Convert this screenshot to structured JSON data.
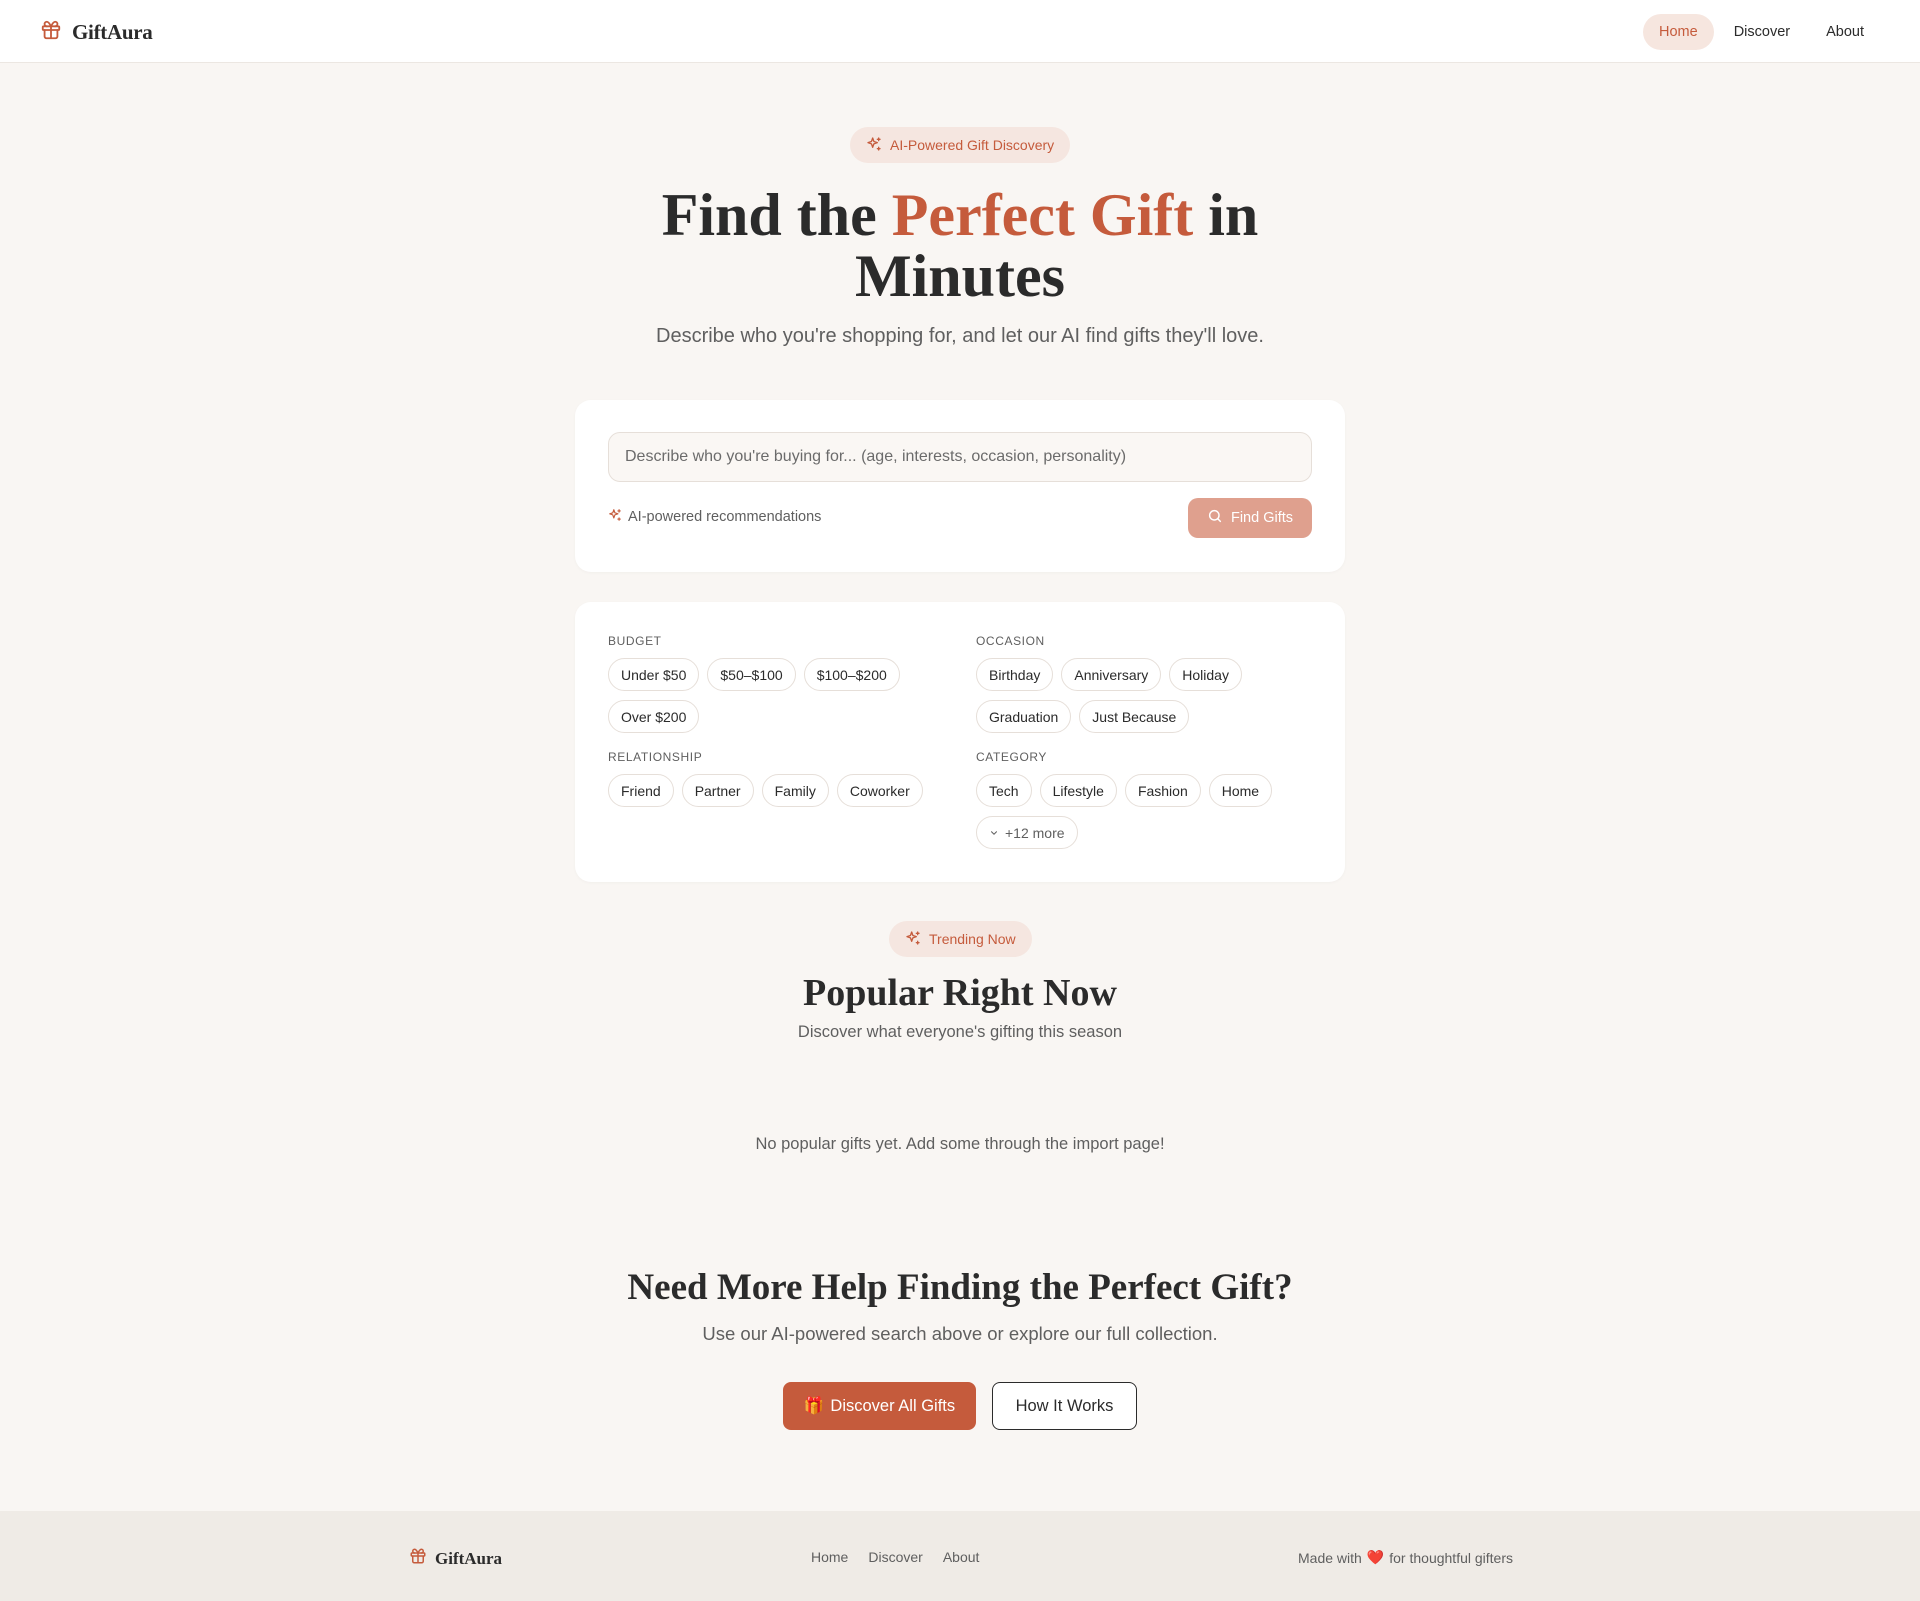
{
  "header": {
    "brand": "GiftAura",
    "nav": [
      "Home",
      "Discover",
      "About"
    ],
    "active_nav": "Home"
  },
  "hero": {
    "badge": "AI-Powered Gift Discovery",
    "title_pre": "Find the ",
    "title_accent": "Perfect Gift",
    "title_post": " in Minutes",
    "subtitle": "Describe who you're shopping for, and let our AI find gifts they'll love."
  },
  "search": {
    "placeholder": "Describe who you're buying for... (age, interests, occasion, personality)",
    "value": "",
    "ai_note": "AI-powered recommendations",
    "button": "Find Gifts"
  },
  "filters": {
    "budget": {
      "label": "Budget",
      "options": [
        "Under $50",
        "$50–$100",
        "$100–$200",
        "Over $200"
      ]
    },
    "occasion": {
      "label": "Occasion",
      "options": [
        "Birthday",
        "Anniversary",
        "Holiday",
        "Graduation",
        "Just Because"
      ]
    },
    "relationship": {
      "label": "Relationship",
      "options": [
        "Friend",
        "Partner",
        "Family",
        "Coworker"
      ]
    },
    "category": {
      "label": "Category",
      "options": [
        "Tech",
        "Lifestyle",
        "Fashion",
        "Home"
      ],
      "more": "+12 more"
    }
  },
  "trending": {
    "badge": "Trending Now",
    "title": "Popular Right Now",
    "subtitle": "Discover what everyone's gifting this season",
    "empty": "No popular gifts yet. Add some through the import page!"
  },
  "help": {
    "title": "Need More Help Finding the Perfect Gift?",
    "subtitle": "Use our AI-powered search above or explore our full collection.",
    "primary_button": "Discover All Gifts",
    "primary_emoji": "🎁",
    "secondary_button": "How It Works"
  },
  "footer": {
    "brand": "GiftAura",
    "links": [
      "Home",
      "Discover",
      "About"
    ],
    "made_pre": "Made with",
    "made_heart": "❤️",
    "made_post": "for thoughtful gifters"
  },
  "colors": {
    "accent": "#c55b3c",
    "accent_light": "#f5e6e0",
    "button_disabled": "#dfa08e",
    "background": "#f9f6f3",
    "footer_bg": "#efebe6"
  },
  "icons": {
    "brand": "gift-icon",
    "badge": "sparkles-icon",
    "search_button": "search-icon",
    "more": "chevron-down-icon"
  }
}
